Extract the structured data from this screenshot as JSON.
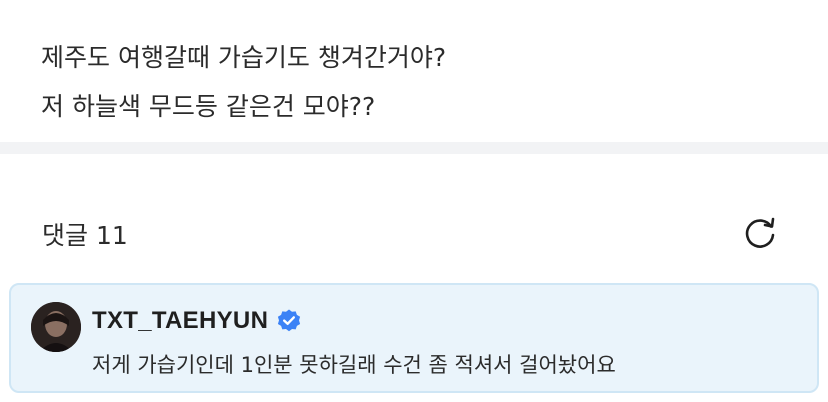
{
  "post": {
    "lines": [
      "제주도 여행갈때 가습기도 챙겨간거야?",
      "저 하늘색 무드등 같은건 모야??"
    ]
  },
  "comments": {
    "title": "댓글 11",
    "refresh_icon": "refresh-icon",
    "pinned_comment": {
      "author": "TXT_TAEHYUN",
      "verified_icon": "verified-badge-icon",
      "text": "저게 가습기인데 1인분 못하길래 수건 좀 적셔서 걸어놨어요"
    }
  },
  "colors": {
    "highlight_background": "#eaf4fb",
    "highlight_border": "#cfe6f5",
    "verified_blue": "#3b82f6",
    "divider": "#f2f3f5"
  }
}
